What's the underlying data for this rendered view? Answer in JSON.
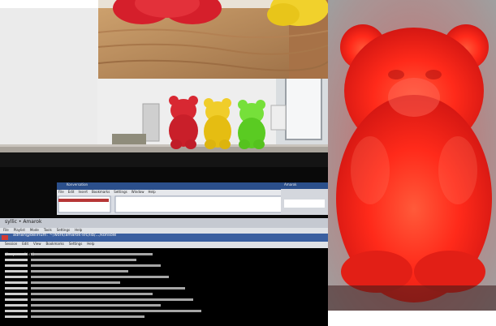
{
  "scene": {
    "top_photo": {
      "subject": "red and yellow gummy bear lamps on wooden shelf"
    },
    "shelf_photo": {
      "subject": "red, yellow and green gummy bear lamps on shelf"
    },
    "right_photo": {
      "subject": "glowing red gummy bear lamp"
    },
    "monitor_photo": {
      "subject": "laptop screen with Konversation and terminal"
    }
  },
  "monitor": {
    "konversation_title": "Konversation",
    "konversation_menu": [
      "File",
      "Edit",
      "Insert",
      "Bookmarks",
      "Settings",
      "Window",
      "Help"
    ],
    "terminal_title": "adrian@delirium: ~/work/amarok-src/lib/.../konsole",
    "terminal_menu": [
      "Session",
      "Edit",
      "View",
      "Bookmarks",
      "Settings",
      "Help"
    ],
    "app_left": "syllic • Amarok",
    "app_left_menu": [
      "File",
      "Playlist",
      "Mode",
      "Tools",
      "Settings",
      "Help"
    ],
    "side_window_title": "Amarok",
    "terminal_prefix": "[lucy.rnuclist]"
  },
  "colors": {
    "red_glow": "#ff2a1a",
    "yellow": "#f2cd1c",
    "green": "#5fd42a",
    "wood": "#b58655"
  }
}
